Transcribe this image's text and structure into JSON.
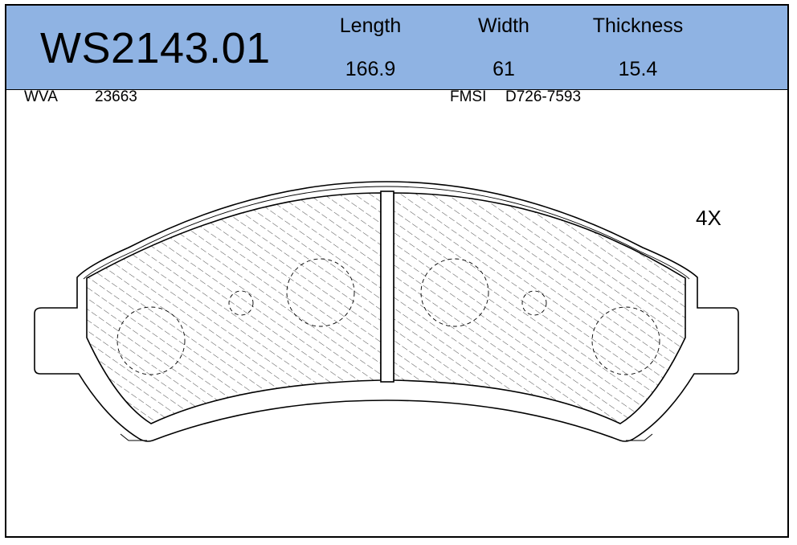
{
  "header": {
    "part_number": "WS2143.01",
    "background": "#8fb3e3",
    "columns": [
      {
        "label": "Length",
        "value": "166.9"
      },
      {
        "label": "Width",
        "value": "61"
      },
      {
        "label": "Thickness",
        "value": "15.4"
      }
    ]
  },
  "refs": {
    "wva_label": "WVA",
    "wva_value": "23663",
    "fmsi_label": "FMSI",
    "fmsi_value": "D726-7593"
  },
  "drawing": {
    "quantity": "4X"
  }
}
